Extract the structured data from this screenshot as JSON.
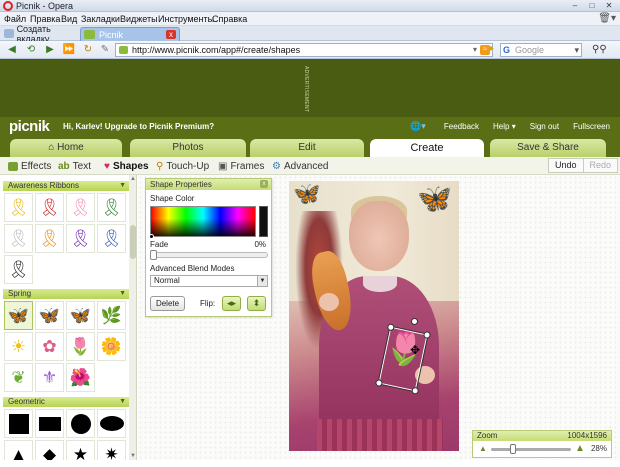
{
  "window": {
    "title": "Picnik - Opera"
  },
  "menu": {
    "items": [
      "Файл",
      "Правка",
      "Вид",
      "Закладки",
      "Виджеты",
      "Инструменты",
      "Справка"
    ]
  },
  "browser_tabs": {
    "new_tab_label": "Создать вкладку",
    "active_tab_label": "Picnik",
    "close_glyph": "x"
  },
  "address": {
    "url": "http://www.picnik.com/app#/create/shapes",
    "search_placeholder": "Google"
  },
  "ad": {
    "label": "ADVERTISEMENT"
  },
  "picnik": {
    "logo": "picnik",
    "greeting": "Hi, Karlev! Upgrade to Picnik Premium?",
    "top_links": [
      "Feedback",
      "Help ▾",
      "Sign out",
      "Fullscreen"
    ],
    "main_tabs": [
      {
        "label": "Home",
        "icon": "home-icon"
      },
      {
        "label": "Photos"
      },
      {
        "label": "Edit"
      },
      {
        "label": "Create",
        "active": true
      },
      {
        "label": "Save & Share"
      }
    ],
    "sub_tools": [
      {
        "label": "Effects",
        "icon": "effects-icon"
      },
      {
        "label": "Text",
        "icon": "text-icon"
      },
      {
        "label": "Shapes",
        "icon": "heart-icon",
        "active": true
      },
      {
        "label": "Touch-Up",
        "icon": "touchup-icon"
      },
      {
        "label": "Frames",
        "icon": "frames-icon"
      },
      {
        "label": "Advanced",
        "icon": "advanced-icon"
      }
    ],
    "undo_label": "Undo",
    "redo_label": "Redo"
  },
  "categories": {
    "awareness": "Awareness Ribbons",
    "spring": "Spring",
    "geometric": "Geometric"
  },
  "shape_properties": {
    "title": "Shape Properties",
    "shape_color_label": "Shape Color",
    "fade_label": "Fade",
    "fade_value": "0%",
    "blend_label": "Advanced Blend Modes",
    "blend_value": "Normal",
    "delete_label": "Delete",
    "flip_label": "Flip:"
  },
  "zoom": {
    "label": "Zoom",
    "dimensions": "1004x1596",
    "percent": "28%",
    "level": 0.28
  },
  "colors": {
    "picnik_green_dark": "#4a5c12",
    "picnik_green": "#5a6e16",
    "tab_green": "#c5dc75",
    "shape_color": "#111111"
  }
}
